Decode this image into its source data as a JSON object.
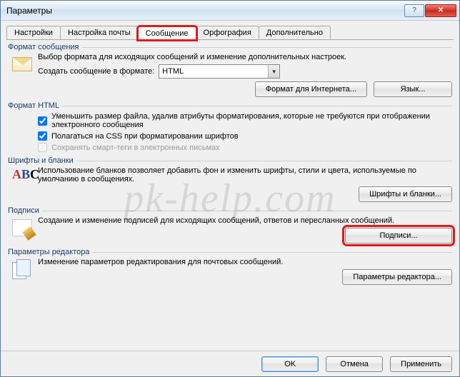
{
  "window": {
    "title": "Параметры"
  },
  "tabs": {
    "general": "Настройки",
    "mail": "Настройка почты",
    "message": "Сообщение",
    "spell": "Орфография",
    "advanced": "Дополнительно"
  },
  "group_format": {
    "title": "Формат сообщения",
    "desc": "Выбор формата для исходящих сообщений и изменение дополнительных настроек.",
    "create_label": "Создать сообщение в формате:",
    "format_value": "HTML",
    "btn_internet": "Формат для Интернета...",
    "btn_lang": "Язык..."
  },
  "group_html": {
    "title": "Формат HTML",
    "cb_reduce": "Уменьшить размер файла, удалив атрибуты форматирования, которые не требуются при отображении электронного сообщения",
    "cb_css": "Полагаться на CSS при форматировании шрифтов",
    "cb_smart": "Сохранять смарт-теги в электронных письмах"
  },
  "group_fonts": {
    "title": "Шрифты и бланки",
    "desc": "Использование бланков позволяет добавить фон и изменить шрифты, стили и цвета, используемые по умолчанию в сообщениях.",
    "btn": "Шрифты и бланки..."
  },
  "group_sig": {
    "title": "Подписи",
    "desc": "Создание и изменение подписей для исходящих сообщений, ответов и пересланных сообщений.",
    "btn": "Подписи..."
  },
  "group_editor": {
    "title": "Параметры редактора",
    "desc": "Изменение параметров редактирования для почтовых сообщений.",
    "btn": "Параметры редактора..."
  },
  "footer": {
    "ok": "OK",
    "cancel": "Отмена",
    "apply": "Применить"
  },
  "watermark": "pk-help.com"
}
